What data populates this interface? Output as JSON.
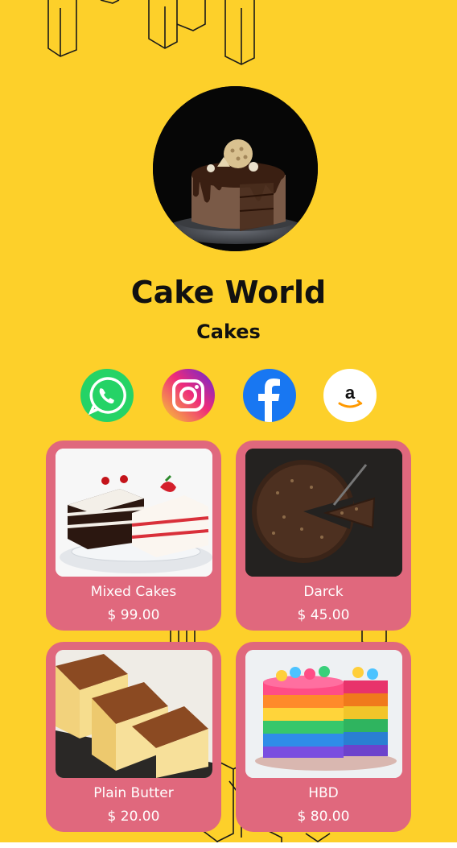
{
  "profile": {
    "title": "Cake World",
    "subtitle": "Cakes",
    "image": "chocolate-cake-photo"
  },
  "social": [
    {
      "name": "whatsapp",
      "icon": "whatsapp-icon",
      "color": "#25D366"
    },
    {
      "name": "instagram",
      "icon": "instagram-icon",
      "color": "#E1306C"
    },
    {
      "name": "facebook",
      "icon": "facebook-icon",
      "color": "#1877F2"
    },
    {
      "name": "amazon",
      "icon": "amazon-icon",
      "color": "#FF9900"
    }
  ],
  "products": [
    {
      "name": "Mixed Cakes",
      "price": "$ 99.00",
      "image": "mixed-cakes-photo"
    },
    {
      "name": "Darck",
      "price": "$ 45.00",
      "image": "dark-chocolate-tart-photo"
    },
    {
      "name": "Plain Butter",
      "price": "$ 20.00",
      "image": "butter-cake-photo"
    },
    {
      "name": "HBD",
      "price": "$ 80.00",
      "image": "rainbow-cake-photo"
    }
  ],
  "colors": {
    "background": "#FDD02A",
    "card": "#E0687D",
    "text": "#111111"
  }
}
